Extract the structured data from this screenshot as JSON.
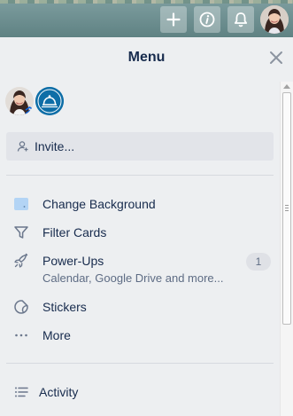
{
  "topbar": {
    "icons": [
      "plus-icon",
      "info-icon",
      "bell-icon"
    ],
    "colors": {
      "bar": "#5f8283",
      "button": "#ffffff"
    }
  },
  "menu": {
    "title": "Menu",
    "invite_label": "Invite...",
    "items": [
      {
        "icon": "background-swatch-icon",
        "label": "Change Background"
      },
      {
        "icon": "filter-icon",
        "label": "Filter Cards"
      },
      {
        "icon": "rocket-icon",
        "label": "Power-Ups",
        "sublabel": "Calendar, Google Drive and more...",
        "count": "1"
      },
      {
        "icon": "sticker-icon",
        "label": "Stickers"
      },
      {
        "icon": "more-icon",
        "label": "More"
      }
    ],
    "activity_label": "Activity"
  }
}
